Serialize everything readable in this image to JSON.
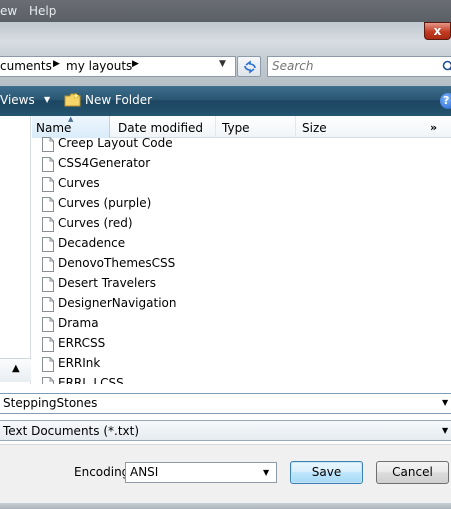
{
  "menu": {
    "view_partial": "ew",
    "help": "Help"
  },
  "window": {
    "close_label": "x"
  },
  "address": {
    "crumbs": [
      "cuments",
      "my layouts"
    ],
    "search_placeholder": "Search"
  },
  "commandbar": {
    "views": "Views",
    "new_folder": "New Folder",
    "help_icon": "?"
  },
  "columns": {
    "name": "Name",
    "date_modified": "Date modified",
    "type": "Type",
    "size": "Size",
    "more": "»"
  },
  "files": [
    "Creep Layout Code",
    "CSS4Generator",
    "Curves",
    "Curves (purple)",
    "Curves (red)",
    "Decadence",
    "DenovoThemesCSS",
    "Desert Travelers",
    "DesignerNavigation",
    "Drama",
    "ERRCSS",
    "ERRInk",
    "ERRI..LCSS"
  ],
  "filename": {
    "value": "SteppingStones"
  },
  "save_as_type": {
    "value": "Text Documents (*.txt)"
  },
  "encoding": {
    "label": "Encoding:",
    "value": "ANSI"
  },
  "buttons": {
    "save": "Save",
    "cancel": "Cancel"
  }
}
